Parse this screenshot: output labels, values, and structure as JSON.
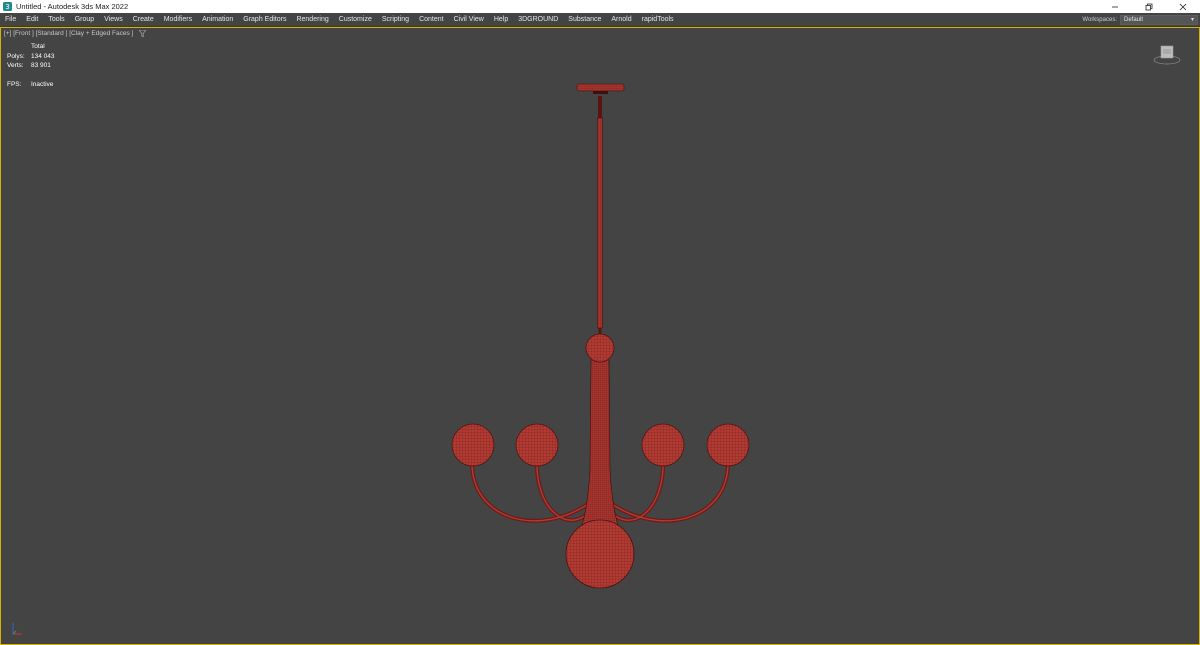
{
  "window": {
    "title": "Untitled - Autodesk 3ds Max 2022",
    "controls": [
      "minimize-icon",
      "restore-icon",
      "close-icon"
    ]
  },
  "menu": {
    "items": [
      {
        "label": "File"
      },
      {
        "label": "Edit"
      },
      {
        "label": "Tools"
      },
      {
        "label": "Group"
      },
      {
        "label": "Views"
      },
      {
        "label": "Create"
      },
      {
        "label": "Modifiers"
      },
      {
        "label": "Animation"
      },
      {
        "label": "Graph Editors"
      },
      {
        "label": "Rendering"
      },
      {
        "label": "Customize"
      },
      {
        "label": "Scripting"
      },
      {
        "label": "Content"
      },
      {
        "label": "Civil View"
      },
      {
        "label": "Help"
      },
      {
        "label": "3DGROUND"
      },
      {
        "label": "Substance"
      },
      {
        "label": "Arnold"
      },
      {
        "label": "rapidTools"
      }
    ]
  },
  "workspace": {
    "label": "Workspaces:",
    "value": "Default"
  },
  "viewport": {
    "label": "[+] [Front ] [Standard ] [Clay + Edged Faces ]",
    "border_color": "#d4b400",
    "stats": {
      "header": "Total",
      "polys_label": "Polys:",
      "polys_value": "134 043",
      "verts_label": "Verts:",
      "verts_value": "83 901",
      "fps_label": "FPS:",
      "fps_value": "Inactive"
    },
    "model_color": "#b13a33",
    "wire_color": "#6a1a16"
  }
}
